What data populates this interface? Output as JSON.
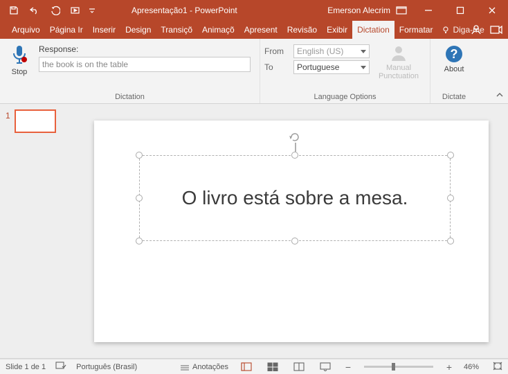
{
  "title": "Apresentação1 - PowerPoint",
  "user": "Emerson Alecrim",
  "tabs": {
    "arquivo": "Arquivo",
    "pagina": "Página Ir",
    "inserir": "Inserir",
    "design": "Design",
    "transicoes": "Transiçõ",
    "animacoes": "Animaçõ",
    "apresentacao": "Apresent",
    "revisao": "Revisão",
    "exibir": "Exibir",
    "dictation": "Dictation",
    "formatar": "Formatar",
    "tellme": "Diga-me"
  },
  "ribbon": {
    "stop": "Stop",
    "response_label": "Response:",
    "response_value": "the book is on the table",
    "from_label": "From",
    "to_label": "To",
    "from_lang": "English (US)",
    "to_lang": "Portuguese",
    "manual_line1": "Manual",
    "manual_line2": "Punctuation",
    "about": "About",
    "group_dictation": "Dictation",
    "group_lang": "Language Options",
    "group_dictate": "Dictate"
  },
  "thumbs": {
    "num1": "1"
  },
  "slide": {
    "text": "O livro está sobre a mesa."
  },
  "status": {
    "slide": "Slide 1 de 1",
    "lang": "Português (Brasil)",
    "notes": "Anotações",
    "zoom": "46%"
  }
}
